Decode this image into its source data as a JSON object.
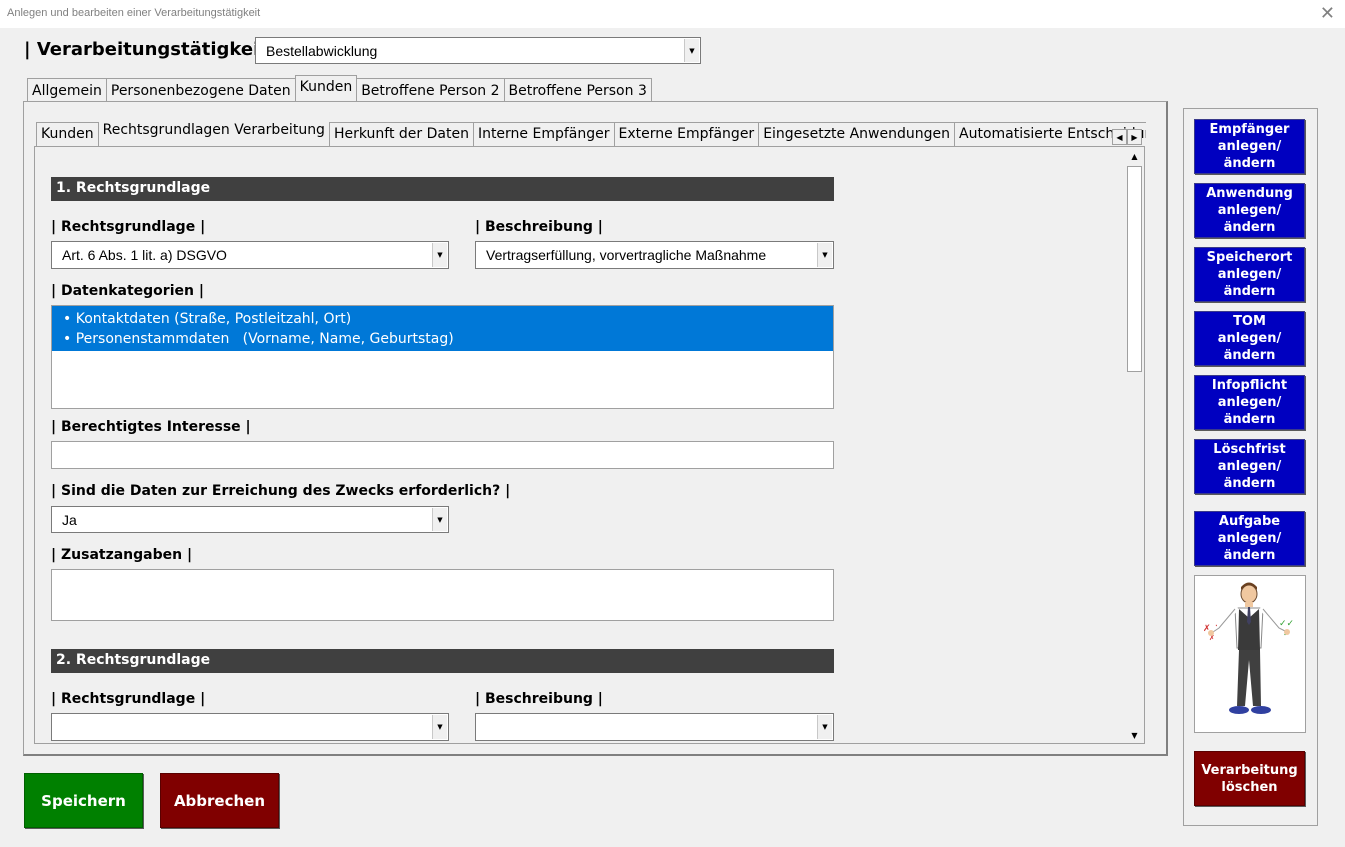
{
  "window": {
    "title": "Anlegen und bearbeiten einer Verarbeitungstätigkeit",
    "close_glyph": "✕"
  },
  "header": {
    "title": "| Verarbeitungstätigkeit |",
    "activity_value": "Bestellabwicklung"
  },
  "outer_tabs": [
    {
      "label": "Allgemein",
      "active": false
    },
    {
      "label": "Personenbezogene Daten",
      "active": false
    },
    {
      "label": "Kunden",
      "active": true
    },
    {
      "label": "Betroffene Person 2",
      "active": false
    },
    {
      "label": "Betroffene Person 3",
      "active": false
    }
  ],
  "inner_tabs": [
    {
      "label": "Kunden",
      "active": false
    },
    {
      "label": "Rechtsgrundlagen Verarbeitung",
      "active": true
    },
    {
      "label": "Herkunft der Daten",
      "active": false
    },
    {
      "label": "Interne Empfänger",
      "active": false
    },
    {
      "label": "Externe Empfänger",
      "active": false
    },
    {
      "label": "Eingesetzte Anwendungen",
      "active": false
    },
    {
      "label": "Automatisierte Entscheidun",
      "active": false
    }
  ],
  "section1": {
    "title": "1. Rechtsgrundlage",
    "rechtsgrundlage_label": "| Rechtsgrundlage |",
    "rechtsgrundlage_value": "Art. 6 Abs. 1 lit. a) DSGVO",
    "beschreibung_label": "| Beschreibung |",
    "beschreibung_value": "Vertragserfüllung, vorvertragliche Maßnahme",
    "datenkategorien_label": "| Datenkategorien |",
    "datenkategorien_items": [
      "• Kontaktdaten (Straße, Postleitzahl, Ort)",
      "• Personenstammdaten   (Vorname, Name, Geburtstag)"
    ],
    "interesse_label": "| Berechtigtes Interesse |",
    "interesse_value": "",
    "erforderlich_label": "| Sind die Daten zur Erreichung des Zwecks erforderlich? |",
    "erforderlich_value": "Ja",
    "zusatz_label": "| Zusatzangaben |",
    "zusatz_value": ""
  },
  "section2": {
    "title": "2. Rechtsgrundlage",
    "rechtsgrundlage_label": "| Rechtsgrundlage |",
    "rechtsgrundlage_value": "",
    "beschreibung_label": "| Beschreibung |",
    "beschreibung_value": ""
  },
  "side_buttons": [
    {
      "line1": "Empfänger",
      "line2": "anlegen/ändern"
    },
    {
      "line1": "Anwendung",
      "line2": "anlegen/ändern"
    },
    {
      "line1": "Speicherort",
      "line2": "anlegen/ändern"
    },
    {
      "line1": "TOM",
      "line2": "anlegen/ändern"
    },
    {
      "line1": "Infopflicht",
      "line2": "anlegen/ändern"
    },
    {
      "line1": "Löschfrist",
      "line2": "anlegen/ändern"
    },
    {
      "line1": "Aufgabe",
      "line2": "anlegen/ändern"
    }
  ],
  "delete_button": {
    "line1": "Verarbeitung",
    "line2": "löschen"
  },
  "footer": {
    "save_label": "Speichern",
    "cancel_label": "Abbrechen"
  },
  "colors": {
    "side_button": "#0000c0",
    "delete_button": "#800000",
    "save_button": "#008000",
    "selection": "#0078d7",
    "section_bar": "#404040"
  }
}
